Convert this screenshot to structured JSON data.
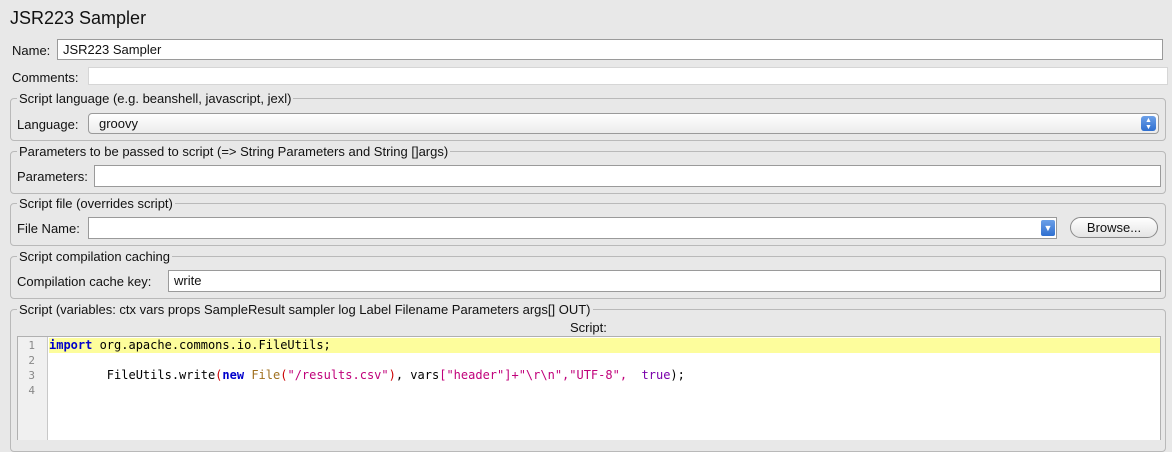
{
  "title": "JSR223 Sampler",
  "name_field": {
    "label": "Name:",
    "value": "JSR223 Sampler"
  },
  "comments": {
    "label": "Comments:",
    "value": ""
  },
  "language_group": {
    "legend": "Script language (e.g. beanshell, javascript, jexl)",
    "label": "Language:",
    "selected": "groovy"
  },
  "parameters_group": {
    "legend": "Parameters to be passed to script (=> String Parameters and String []args)",
    "label": "Parameters:",
    "value": ""
  },
  "script_file_group": {
    "legend": "Script file (overrides script)",
    "label": "File Name:",
    "value": "",
    "browse_label": "Browse..."
  },
  "caching_group": {
    "legend": "Script compilation caching",
    "label": "Compilation cache key:",
    "value": "write"
  },
  "script_group": {
    "legend": "Script (variables: ctx vars props SampleResult sampler log Label Filename Parameters args[] OUT)",
    "caption": "Script:",
    "line_numbers": [
      "1",
      "2",
      "3",
      "4"
    ],
    "lines": [
      {
        "tokens": [
          {
            "t": "import",
            "c": "kw"
          },
          {
            "t": " org.apache.commons.io.FileUtils;",
            "c": ""
          }
        ],
        "highlighted": true
      },
      {
        "tokens": [],
        "highlighted": false
      },
      {
        "tokens": [
          {
            "t": "        FileUtils.write",
            "c": ""
          },
          {
            "t": "(",
            "c": "paren"
          },
          {
            "t": "new",
            "c": "kw"
          },
          {
            "t": " ",
            "c": ""
          },
          {
            "t": "File",
            "c": "type"
          },
          {
            "t": "(",
            "c": "paren"
          },
          {
            "t": "\"/results.csv\"",
            "c": "str"
          },
          {
            "t": ")",
            "c": "paren"
          },
          {
            "t": ", vars",
            "c": ""
          },
          {
            "t": "[\"header\"]+\"\\r\\n\",\"UTF-8\",",
            "c": "str"
          },
          {
            "t": "  ",
            "c": ""
          },
          {
            "t": "true",
            "c": "bool"
          },
          {
            "t": ");",
            "c": ""
          }
        ],
        "highlighted": false
      },
      {
        "tokens": [],
        "highlighted": false
      }
    ]
  },
  "colors": {
    "background": "#e8e8e8",
    "current_line": "#fdfd9c",
    "keyword": "#0000cc",
    "string": "#c0007a"
  }
}
